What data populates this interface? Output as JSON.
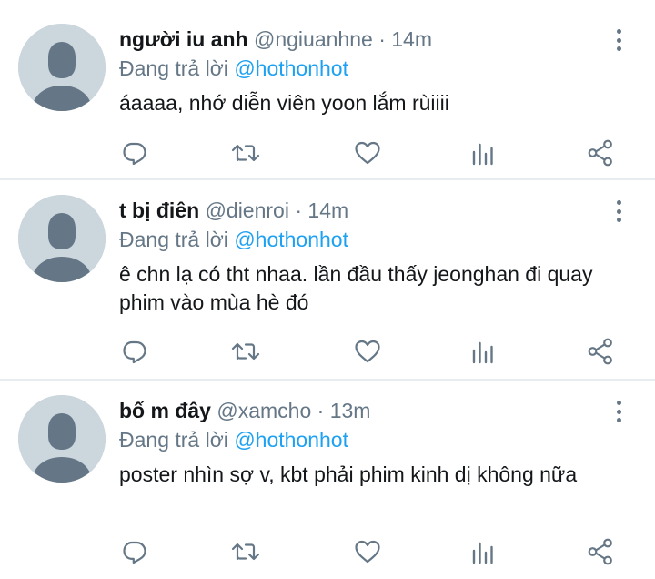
{
  "colors": {
    "accent": "#1da1f2",
    "muted": "#657786",
    "text": "#14171a",
    "avatar_bg": "#ccd6dd",
    "avatar_fg": "#657786",
    "divider": "#e6ecf0"
  },
  "icons": [
    "more-vertical-icon",
    "reply-icon",
    "retweet-icon",
    "like-icon",
    "analytics-icon",
    "share-icon"
  ],
  "tweets": [
    {
      "name": "người iu anh",
      "handle": "@ngiuanhne",
      "separator": "·",
      "time": "14m",
      "reply_prefix": "Đang trả lời",
      "reply_to": "@hothonhot",
      "text": "áaaaa, nhớ diễn viên yoon lắm rùiiii"
    },
    {
      "name": "t bị điên",
      "handle": "@dienroi",
      "separator": "·",
      "time": "14m",
      "reply_prefix": "Đang trả lời",
      "reply_to": "@hothonhot",
      "text": "ê chn lạ có tht nhaa. lần đầu thấy jeonghan đi quay phim vào mùa hè đó"
    },
    {
      "name": "bố m đây",
      "handle": "@xamcho",
      "separator": "·",
      "time": "13m",
      "reply_prefix": "Đang trả lời",
      "reply_to": "@hothonhot",
      "text": "poster nhìn sợ v, kbt phải phim kinh dị không nữa"
    }
  ]
}
